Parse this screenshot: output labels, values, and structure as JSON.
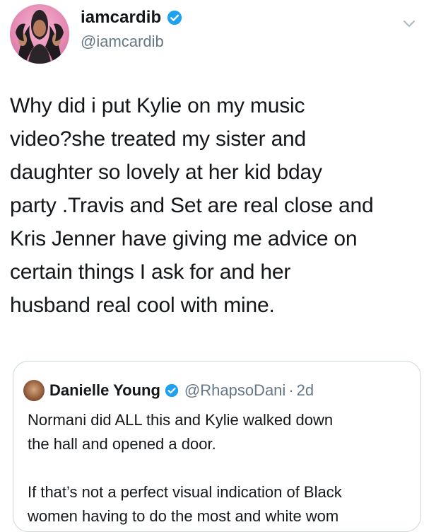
{
  "tweet": {
    "display_name": "iamcardib",
    "handle": "@iamcardib",
    "text": "Why did i put Kylie on my music\nvideo?she treated my sister and\ndaughter so lovely at her kid bday\nparty .Travis and Set are real close and\nKris Jenner have giving me advice on\ncertain things I ask for and her\nhusband real cool with mine.",
    "icons": {
      "verified": "verified-badge-icon",
      "menu": "chevron-down-icon"
    }
  },
  "quote": {
    "display_name": "Danielle Young",
    "handle": "@RhapsoDani",
    "separator": "·",
    "time": "2d",
    "text": "Normani did ALL this and Kylie walked down\nthe hall and opened a door.\n\nIf that’s not a perfect visual indication of Black\nwomen having to do the most and white wom"
  },
  "colors": {
    "verified_blue": "#1da1f2",
    "secondary_text": "#657786",
    "border": "#ccd6dd"
  }
}
